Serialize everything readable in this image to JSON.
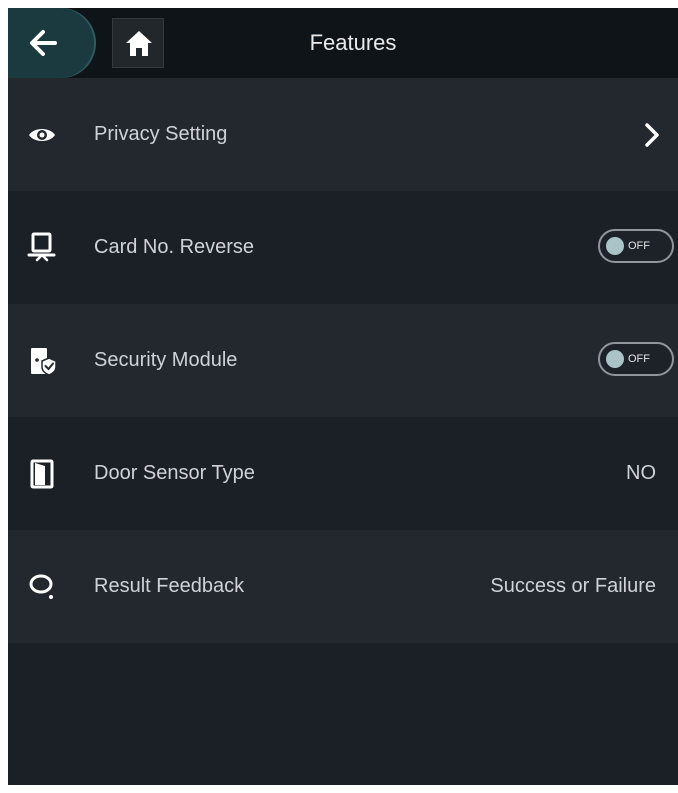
{
  "header": {
    "title": "Features",
    "back_icon": "back-arrow-icon",
    "home_icon": "home-icon"
  },
  "items": [
    {
      "label": "Privacy Setting",
      "icon": "eye-icon",
      "control": "chevron"
    },
    {
      "label": "Card No. Reverse",
      "icon": "card-reader-icon",
      "control": "toggle",
      "state": "OFF"
    },
    {
      "label": "Security Module",
      "icon": "security-module-icon",
      "control": "toggle",
      "state": "OFF"
    },
    {
      "label": "Door Sensor Type",
      "icon": "door-icon",
      "control": "value",
      "value": "NO"
    },
    {
      "label": "Result Feedback",
      "icon": "feedback-icon",
      "control": "value",
      "value": "Success or Failure"
    }
  ],
  "colors": {
    "background": "#1e2329",
    "header": "#0f1418",
    "back_button": "#1b3a40",
    "text": "#cfd3d7",
    "toggle_knob": "#a9c3c6"
  }
}
